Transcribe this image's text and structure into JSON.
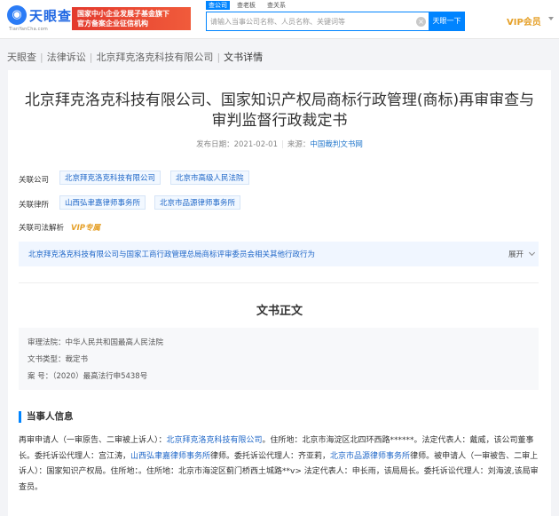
{
  "header": {
    "logo_name": "天眼查",
    "logo_url": "TianYanCha.com",
    "banner_line1": "国家中小企业发展子基金旗下",
    "banner_line2": "官方备案企业征信机构",
    "tabs": [
      "查公司",
      "查老板",
      "查关系"
    ],
    "search_placeholder": "请输入当事公司名称、人员名称、关键词等",
    "search_button": "天眼一下",
    "vip_label": "VIP会员"
  },
  "breadcrumb": [
    "天眼查",
    "法律诉讼",
    "北京拜克洛克科技有限公司",
    "文书详情"
  ],
  "document": {
    "title_line1": "北京拜克洛克科技有限公司、国家知识产权局商标行政管理(商标)再审审查与",
    "title_line2": "审判监督行政裁定书",
    "publish_label": "发布日期：",
    "publish_date": "2021-02-01",
    "source_label": "来源：",
    "source": "中国裁判文书网"
  },
  "related": {
    "company_label": "关联公司",
    "companies": [
      "北京拜克洛克科技有限公司",
      "北京市高级人民法院"
    ],
    "lawfirm_label": "关联律所",
    "lawfirms": [
      "山西弘聿嘉律师事务所",
      "北京市品源律师事务所"
    ],
    "analysis_label": "关联司法解析",
    "vip_tag": "VIP专属",
    "analysis_text": "北京拜克洛克科技有限公司与国家工商行政管理总局商标评审委员会相关其他行政行为",
    "expand_label": "展开"
  },
  "body": {
    "section_title": "文书正文",
    "court": "审理法院：中华人民共和国最高人民法院",
    "doc_type": "文书类型：裁定书",
    "case_no": "案        号：（2020）最高法行申5438号",
    "parties_title": "当事人信息",
    "para": {
      "p1": "再审申请人（一审原告、二审被上诉人）：",
      "l1": "北京拜克洛克科技有限公司",
      "p2": "。住所地：北京市海淀区北四环西路******。法定代表人：戴威，该公司董事长。委托诉讼代理人：宫江涛，",
      "l2": "山西弘聿嘉律师事务所",
      "p3": "律师。委托诉讼代理人：齐亚莉，",
      "l3": "北京市品源律师事务所",
      "p4": "律师。被申请人（一审被告、二审上诉人）：国家知识产权局。住所地：。住所地：北京市海淀区蓟门桥西土城路**v> 法定代表人：申长雨，该局局长。委托诉讼代理人：刘海波,该局审查员。"
    }
  },
  "colors": {
    "accent": "#0084ff",
    "link": "#1f67c8",
    "vip": "#e5a028",
    "banner_red": "#e43a2d"
  },
  "icons": {
    "clear": "clear-circle-icon",
    "expand": "chevron-down-icon",
    "vip_caret": "caret-down-icon"
  }
}
